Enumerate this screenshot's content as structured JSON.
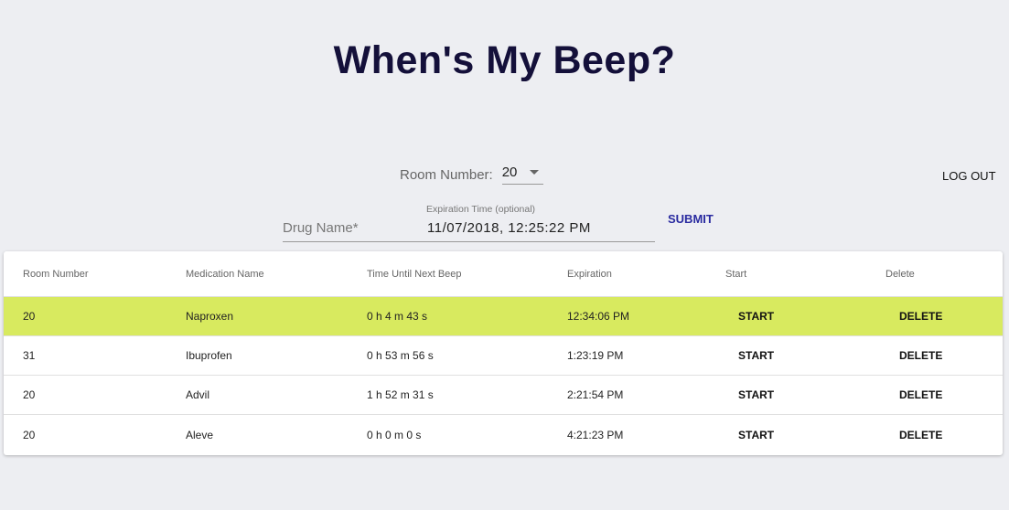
{
  "title": "When's My Beep?",
  "room_select": {
    "label": "Room Number:",
    "value": "20"
  },
  "logout_label": "LOG OUT",
  "drug_field": {
    "label": "Drug Name",
    "required": "*"
  },
  "expiration_field": {
    "label": "Expiration Time (optional)",
    "value": "11/07/2018, 12:25:22 PM"
  },
  "submit_label": "SUBMIT",
  "table": {
    "headers": [
      "Room Number",
      "Medication Name",
      "Time Until Next Beep",
      "Expiration",
      "Start",
      "Delete"
    ],
    "rows": [
      {
        "room": "20",
        "med": "Naproxen",
        "time": "0 h 4 m 43 s",
        "exp": "12:34:06 PM",
        "start": "START",
        "delete": "DELETE",
        "highlighted": true
      },
      {
        "room": "31",
        "med": "Ibuprofen",
        "time": "0 h 53 m 56 s",
        "exp": "1:23:19 PM",
        "start": "START",
        "delete": "DELETE"
      },
      {
        "room": "20",
        "med": "Advil",
        "time": "1 h 52 m 31 s",
        "exp": "2:21:54 PM",
        "start": "START",
        "delete": "DELETE"
      },
      {
        "room": "20",
        "med": "Aleve",
        "time": "0 h 0 m 0 s",
        "exp": "4:21:23 PM",
        "start": "START",
        "delete": "DELETE"
      }
    ]
  },
  "colors": {
    "highlight": "#d8ea5f",
    "accent": "#2a2ba0",
    "title": "#14103a"
  }
}
